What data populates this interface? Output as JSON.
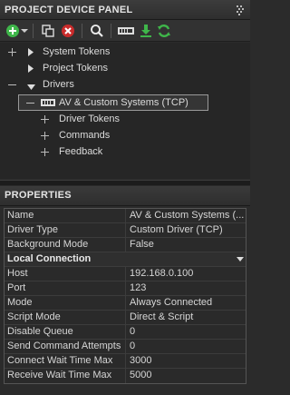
{
  "panel": {
    "title": "PROJECT DEVICE PANEL"
  },
  "toolbar": {
    "icons": [
      "add-icon",
      "dropdown-arrow-icon",
      "copy-icon",
      "delete-icon",
      "search-icon",
      "device-icon",
      "download-icon",
      "refresh-icon"
    ]
  },
  "tree": {
    "system_tokens": "System Tokens",
    "project_tokens": "Project Tokens",
    "drivers": "Drivers",
    "device": "AV & Custom Systems (TCP)",
    "driver_tokens": "Driver Tokens",
    "commands": "Commands",
    "feedback": "Feedback"
  },
  "properties": {
    "title": "PROPERTIES",
    "rows": [
      {
        "key": "Name",
        "value": "AV & Custom Systems (..."
      },
      {
        "key": "Driver Type",
        "value": "Custom Driver (TCP)"
      },
      {
        "key": "Background Mode",
        "value": "False"
      }
    ],
    "section": "Local Connection",
    "conn_rows": [
      {
        "key": "Host",
        "value": "192.168.0.100"
      },
      {
        "key": "Port",
        "value": "123"
      },
      {
        "key": "Mode",
        "value": "Always Connected"
      },
      {
        "key": "Script Mode",
        "value": "Direct & Script"
      },
      {
        "key": "Disable Queue",
        "value": "0"
      },
      {
        "key": "Send Command Attempts",
        "value": "0"
      },
      {
        "key": "Connect Wait Time Max",
        "value": "3000"
      },
      {
        "key": "Receive Wait Time Max",
        "value": "5000"
      }
    ]
  },
  "colors": {
    "accent_green": "#3fb64a",
    "delete_red": "#c92b2b",
    "selection_border": "#9a9a9a"
  }
}
